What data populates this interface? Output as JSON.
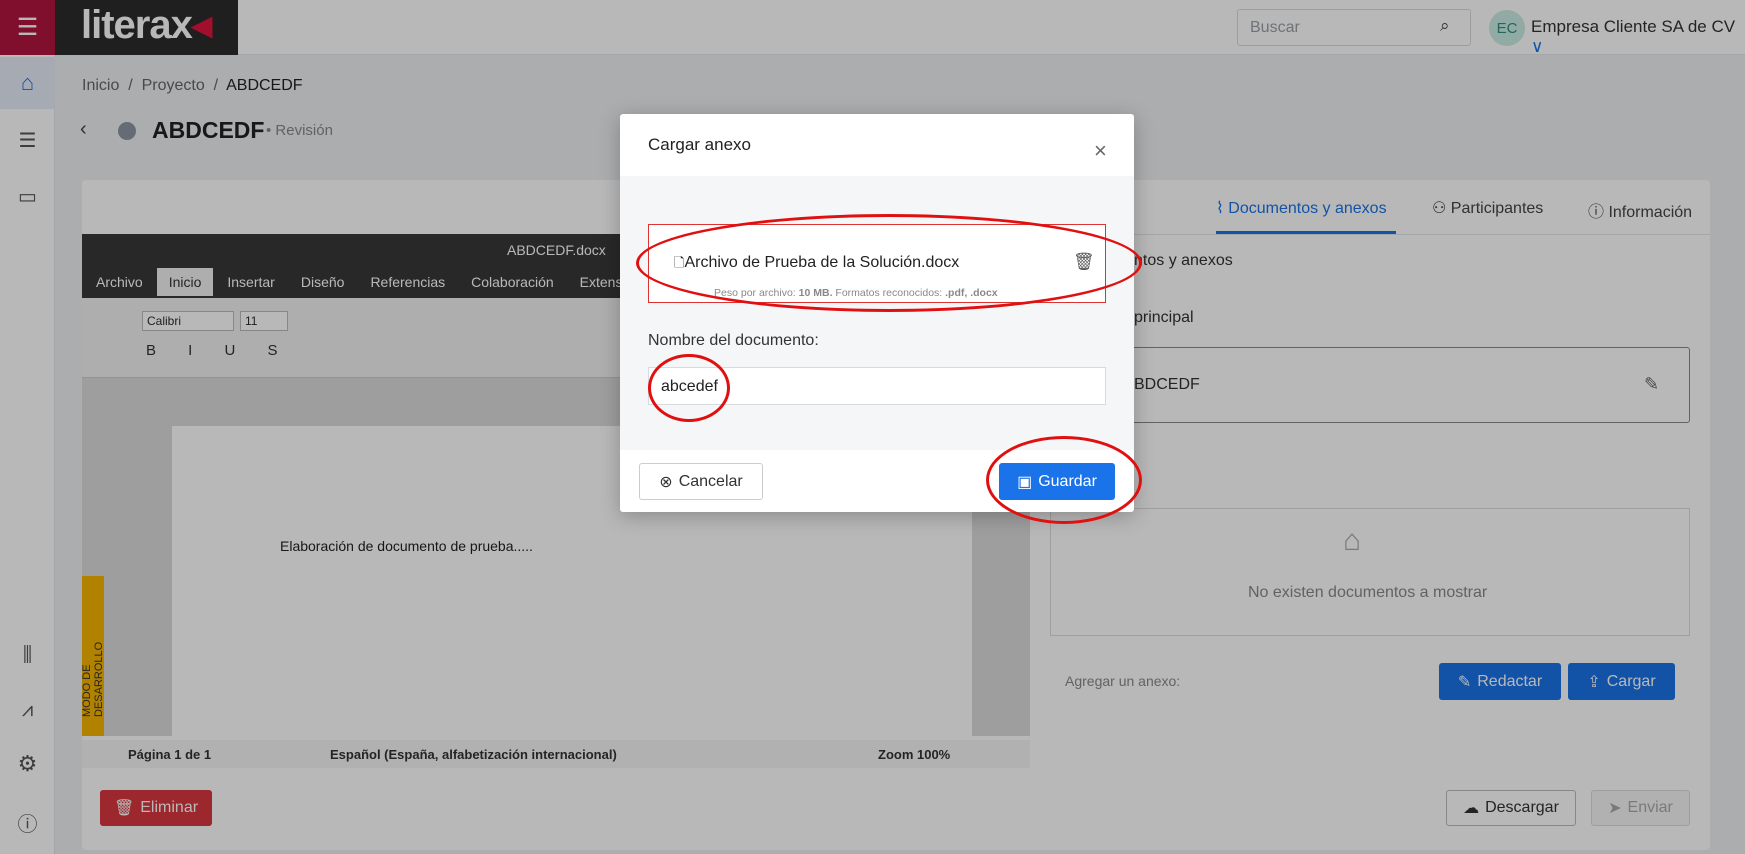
{
  "topbar": {
    "logo": "literax",
    "search_placeholder": "Buscar",
    "avatar_initials": "EC",
    "company": "Empresa Cliente SA de CV"
  },
  "breadcrumb": [
    "Inicio",
    "/",
    "Proyecto",
    "/",
    "ABDCEDF"
  ],
  "page": {
    "title": "ABDCEDF",
    "status": "Revisión"
  },
  "editor": {
    "filename": "ABDCEDF.docx",
    "menu": [
      "Archivo",
      "Inicio",
      "Insertar",
      "Diseño",
      "Referencias",
      "Colaboración",
      "Extens"
    ],
    "font": "Calibri",
    "size": "11",
    "doc_text": "Elaboración de documento de prueba.....",
    "dev_mode": "MODO DE DESARROLLO",
    "status": {
      "page": "Página 1 de 1",
      "language": "Español (España, alfabetización internacional)",
      "zoom": "Zoom 100%"
    }
  },
  "right_panel": {
    "tabs": [
      "Documentos y anexos",
      "Participantes",
      "Información"
    ],
    "section": "ntos y anexos",
    "main_label": "principal",
    "main_doc": "BDCEDF",
    "empty": "No existen documentos a mostrar",
    "add_label": "Agregar un anexo:",
    "btn_redactar": "Redactar",
    "btn_cargar": "Cargar"
  },
  "footer": {
    "delete": "Eliminar",
    "download": "Descargar",
    "send": "Enviar"
  },
  "modal": {
    "title": "Cargar anexo",
    "file_name": "Archivo de Prueba de la Solución.docx",
    "hint_prefix": "Peso por archivo: ",
    "hint_size": "10 MB.",
    "hint_mid": " Formatos reconocidos: ",
    "hint_formats": ".pdf, .docx",
    "field_label": "Nombre del documento",
    "field_value": "abcedef",
    "cancel": "Cancelar",
    "save": "Guardar"
  }
}
